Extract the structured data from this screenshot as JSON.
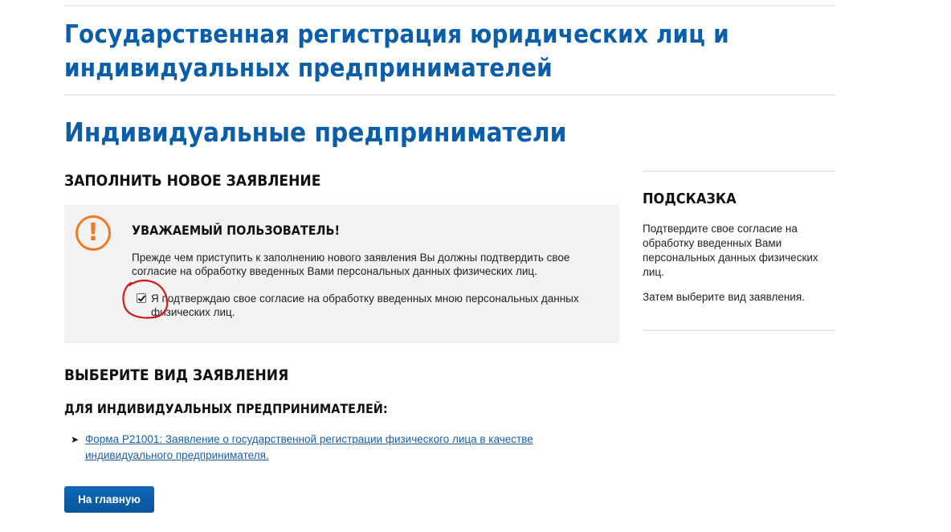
{
  "page_title": "Государственная регистрация юридических лиц и индивидуальных предпринимателей",
  "section_title": "Индивидуальные предприниматели",
  "new_application": {
    "heading": "ЗАПОЛНИТЬ НОВОЕ ЗАЯВЛЕНИЕ",
    "notice": {
      "icon": "exclamation-circle-icon",
      "title": "УВАЖАЕМЫЙ ПОЛЬЗОВАТЕЛЬ!",
      "text": "Прежде чем приступить к заполнению нового заявления Вы должны подтвердить свое согласие на обработку введенных Вами персональных данных физических лиц.",
      "consent_label": "Я подтверждаю свое согласие на обработку введенных мною персональных данных физических лиц.",
      "consent_checked": true
    }
  },
  "hint": {
    "title": "ПОДСКАЗКА",
    "text1": "Подтвердите свое согласие на обработку введенных Вами персональных данных физических лиц.",
    "text2": "Затем выберите вид заявления."
  },
  "choose": {
    "heading": "ВЫБЕРИТЕ ВИД ЗАЯВЛЕНИЯ",
    "subheading": "ДЛЯ ИНДИВИДУАЛЬНЫХ ПРЕДПРИНИМАТЕЛЕЙ:",
    "forms": [
      {
        "label": "Форма Р21001: Заявление о государственной регистрации физического лица в качестве индивидуального предпринимателя."
      }
    ]
  },
  "home_button": "На главную",
  "colors": {
    "title_blue": "#0b5ea8",
    "link_blue": "#1a5fa8",
    "warning_orange": "#f07a22",
    "annotation_red": "#d11a1a"
  }
}
